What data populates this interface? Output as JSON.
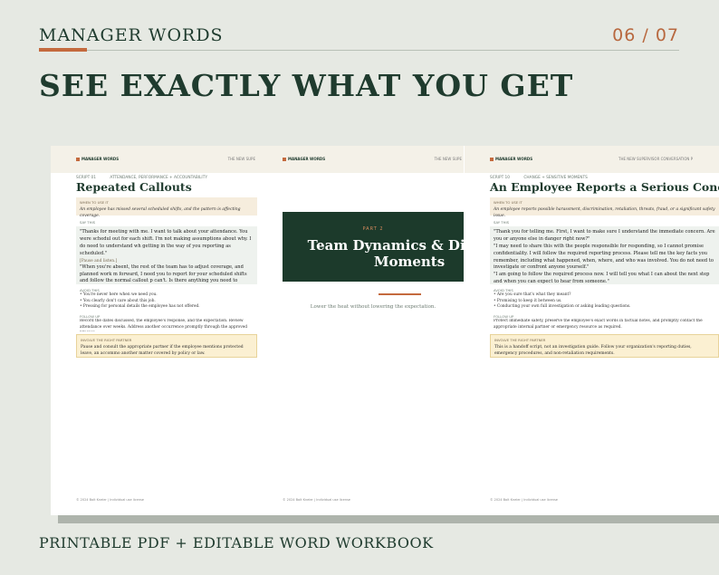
{
  "header": {
    "brand": "MANAGER WORDS",
    "page": "06 / 07"
  },
  "headline": "SEE EXACTLY WHAT YOU GET",
  "docs": [
    {
      "header_left": "MANAGER WORDS",
      "header_right": "THE NEW SUPE",
      "script_no": "SCRIPT 01",
      "category": "ATTENDANCE, PERFORMANCE + ACCOUNTABILITY",
      "title": "Repeated Callouts",
      "when_label": "WHEN TO USE IT",
      "when_text": "An employee has missed several scheduled shifts, and the pattern is affecting coverage.",
      "say_label": "SAY THIS",
      "say_1": "\"Thanks for meeting with me. I want to talk about your attendance. You were schedul out for each shift. I'm not making assumptions about why. I do need to understand wh getting in the way of you reporting as scheduled.\"",
      "pause": "[Pause and listen.]",
      "say_2": "\"When you're absent, the rest of the team has to adjust coverage, and planned work m forward, I need you to report for your scheduled shifts and follow the normal callout p can't. Is there anything you need to clarify about that expectation?\"",
      "avoid_label": "AVOID THIS",
      "avoid": [
        "• You're never here when we need you.",
        "• You clearly don't care about this job.",
        "• Pressing for personal details the employee has not offered."
      ],
      "follow_label": "FOLLOW UP",
      "follow_text": "Record the dates discussed, the employee's response, and the expectation. Review attendance over weeks. Address another occurrence promptly through the approved process.",
      "involve_label": "INVOLVE THE RIGHT PARTNER",
      "involve_text": "Pause and consult the appropriate partner if the employee mentions protected leave, an accommo another matter covered by policy or law.",
      "footer": "© 2024 Bolt Kneier | Individual use license"
    },
    {
      "header_left": "MANAGER WORDS",
      "header_right": "THE NEW SUPE",
      "part_label": "PART 2",
      "part_title": "Team Dynamics & Difficult Moments",
      "part_sub": "Lower the heat without lowering the expectation.",
      "footer": "© 2024 Bolt Kneier | Individual use license"
    },
    {
      "header_left": "MANAGER WORDS",
      "header_right": "THE NEW SUPERVISOR CONVERSATION P",
      "script_no": "SCRIPT 10",
      "category": "CHANGE + SENSITIVE MOMENTS",
      "title": "An Employee Reports a Serious Concern",
      "when_label": "WHEN TO USE IT",
      "when_text": "An employee reports possible harassment, discrimination, retaliation, threats, fraud, or a significant safety issue.",
      "say_label": "SAY THIS",
      "say_1": "\"Thank you for telling me. First, I want to make sure I understand the immediate concern. Are you or anyone else in danger right now?\"",
      "say_2": "\"I may need to share this with the people responsible for responding, so I cannot promise confidentiality. I will follow the required reporting process. Please tell me the key facts you remember, including what happened, when, where, and who was involved. You do not need to investigate or confront anyone yourself.\"",
      "say_3": "\"I am going to follow the required process now. I will tell you what I can about the next step and when you can expect to hear from someone.\"",
      "avoid_label": "AVOID THIS",
      "avoid": [
        "• Are you sure that's what they meant?",
        "• Promising to keep it between us.",
        "• Conducting your own full investigation or asking leading questions."
      ],
      "follow_label": "FOLLOW UP",
      "follow_text": "Protect immediate safety, preserve the employee's exact words in factual notes, and promptly contact the appropriate internal partner or emergency resource as required.",
      "involve_label": "INVOLVE THE RIGHT PARTNER",
      "involve_text": "This is a handoff script, not an investigation guide. Follow your organization's reporting duties, emergency procedures, and non-retaliation requirements.",
      "footer": "© 2024 Bolt Kneier | Individual use license"
    }
  ],
  "tagline": "PRINTABLE PDF  +  EDITABLE WORD WORKBOOK"
}
